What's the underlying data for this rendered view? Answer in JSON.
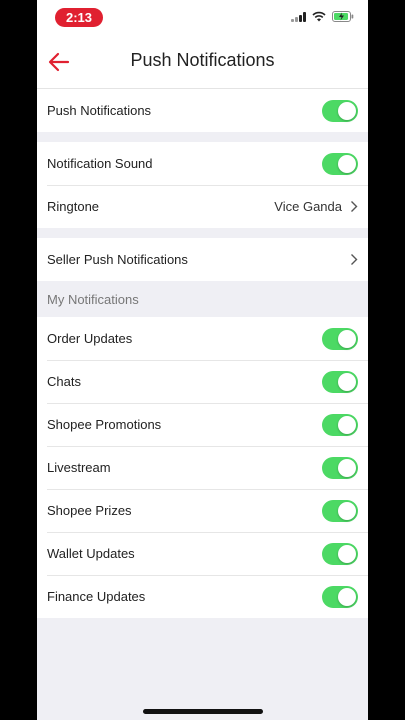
{
  "status_bar": {
    "time": "2:13"
  },
  "header": {
    "title": "Push Notifications",
    "back_icon": "arrow-left-icon",
    "accent_color": "#e02030"
  },
  "settings": {
    "push_notifications": {
      "label": "Push Notifications",
      "enabled": true
    },
    "notification_sound": {
      "label": "Notification Sound",
      "enabled": true
    },
    "ringtone": {
      "label": "Ringtone",
      "value": "Vice Ganda"
    },
    "seller_push": {
      "label": "Seller Push Notifications"
    }
  },
  "my_notifications": {
    "header": "My Notifications",
    "items": [
      {
        "label": "Order Updates",
        "enabled": true
      },
      {
        "label": "Chats",
        "enabled": true
      },
      {
        "label": "Shopee Promotions",
        "enabled": true
      },
      {
        "label": "Livestream",
        "enabled": true
      },
      {
        "label": "Shopee Prizes",
        "enabled": true
      },
      {
        "label": "Wallet Updates",
        "enabled": true
      },
      {
        "label": "Finance Updates",
        "enabled": true
      }
    ]
  },
  "colors": {
    "toggle_on": "#4cd964",
    "background": "#efeff4"
  }
}
